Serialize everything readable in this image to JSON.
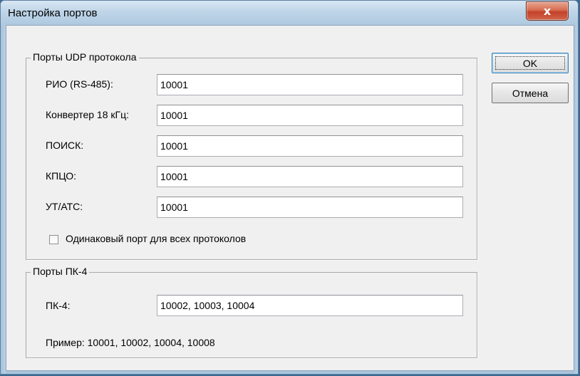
{
  "window": {
    "title": "Настройка портов",
    "close_glyph": "x"
  },
  "udp_group": {
    "title": "Порты UDP протокола",
    "rows": [
      {
        "label": "РИО (RS-485):",
        "value": "10001"
      },
      {
        "label": "Конвертер 18 кГц:",
        "value": "10001"
      },
      {
        "label": "ПОИСК:",
        "value": "10001"
      },
      {
        "label": "КПЦО:",
        "value": "10001"
      },
      {
        "label": "УТ/АТС:",
        "value": "10001"
      }
    ],
    "same_port_checkbox": {
      "label": "Одинаковый порт для всех протоколов",
      "checked": false
    }
  },
  "pk4_group": {
    "title": "Порты ПК-4",
    "label": "ПК-4:",
    "value": "10002, 10003, 10004",
    "example": "Пример: 10001, 10002, 10004, 10008"
  },
  "buttons": {
    "ok": "OK",
    "cancel": "Отмена"
  },
  "colors": {
    "close_button": "#c4412a",
    "dialog_bg": "#f0f0f0",
    "title_bar": "#bfd5e8"
  }
}
